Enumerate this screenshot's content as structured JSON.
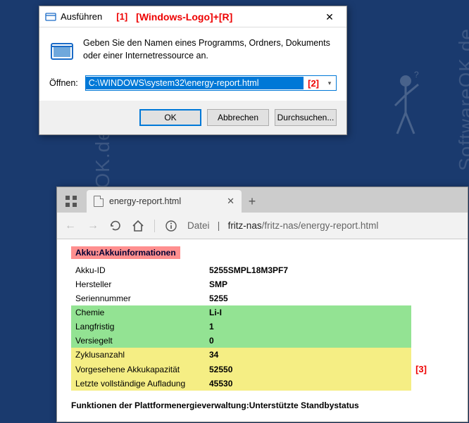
{
  "annotations": {
    "a1": "[1]",
    "shortcut": "[Windows-Logo]+[R]",
    "a2": "[2]",
    "a3": "[3]"
  },
  "watermark": "www.SoftwareOK.de  :-)",
  "watermark2": "SoftwareOK.de",
  "run_dialog": {
    "title": "Ausführen",
    "description": "Geben Sie den Namen eines Programms, Ordners, Dokuments oder einer Internetressource an.",
    "open_label": "Öffnen:",
    "open_value": "C:\\WINDOWS\\system32\\energy-report.html",
    "buttons": {
      "ok": "OK",
      "cancel": "Abbrechen",
      "browse": "Durchsuchen..."
    }
  },
  "browser": {
    "tab_title": "energy-report.html",
    "addr_prefix": "Datei",
    "addr_sep": "|",
    "addr_host": "fritz-nas",
    "addr_path": "/fritz-nas/energy-report.html"
  },
  "report": {
    "heading": "Akku:Akkuinformationen",
    "rows": [
      {
        "label": "Akku-ID",
        "value": "5255SMPL18M3PF7",
        "cls": "plain"
      },
      {
        "label": "Hersteller",
        "value": "SMP",
        "cls": "plain"
      },
      {
        "label": "Seriennummer",
        "value": "5255",
        "cls": "plain"
      },
      {
        "label": "Chemie",
        "value": "Li-I",
        "cls": "green"
      },
      {
        "label": "Langfristig",
        "value": "1",
        "cls": "green"
      },
      {
        "label": "Versiegelt",
        "value": "0",
        "cls": "green"
      },
      {
        "label": "Zyklusanzahl",
        "value": "34",
        "cls": "yellow"
      },
      {
        "label": "Vorgesehene Akkukapazität",
        "value": "52550",
        "cls": "yellow"
      },
      {
        "label": "Letzte vollständige Aufladung",
        "value": "45530",
        "cls": "yellow"
      }
    ],
    "sub": "Funktionen der Plattformenergieverwaltung:Unterstützte Standbystatus"
  }
}
